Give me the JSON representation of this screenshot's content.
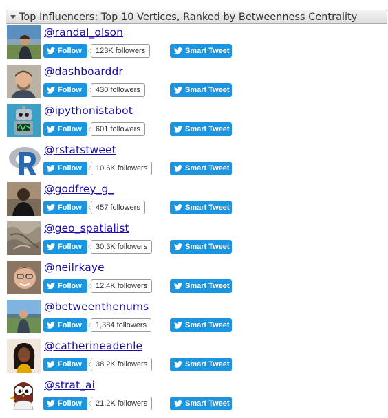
{
  "panel": {
    "title": "Top Influencers: Top 10 Vertices, Ranked by Betweenness Centrality"
  },
  "buttons": {
    "follow_label": "Follow",
    "smart_tweet_label": "Smart Tweet"
  },
  "influencers": [
    {
      "handle": "@randal_olson",
      "followers": "123K followers",
      "avatar": "person-outdoor-avatar"
    },
    {
      "handle": "@dashboarddr",
      "followers": "430 followers",
      "avatar": "person-portrait-avatar"
    },
    {
      "handle": "@ipythonistabot",
      "followers": "601 followers",
      "avatar": "robot-avatar"
    },
    {
      "handle": "@rstatstweet",
      "followers": "10.6K followers",
      "avatar": "r-logo-avatar"
    },
    {
      "handle": "@godfrey_g_",
      "followers": "457 followers",
      "avatar": "person-dark-avatar"
    },
    {
      "handle": "@geo_spatialist",
      "followers": "30.3K followers",
      "avatar": "terrain-map-avatar"
    },
    {
      "handle": "@neilrkaye",
      "followers": "12.4K followers",
      "avatar": "person-selfie-avatar"
    },
    {
      "handle": "@betweenthenums",
      "followers": "1,384 followers",
      "avatar": "person-landscape-avatar"
    },
    {
      "handle": "@catherineadenle",
      "followers": "38.2K followers",
      "avatar": "person-woman-avatar"
    },
    {
      "handle": "@strat_ai",
      "followers": "21.2K followers",
      "avatar": "owl-cartoon-avatar"
    }
  ]
}
